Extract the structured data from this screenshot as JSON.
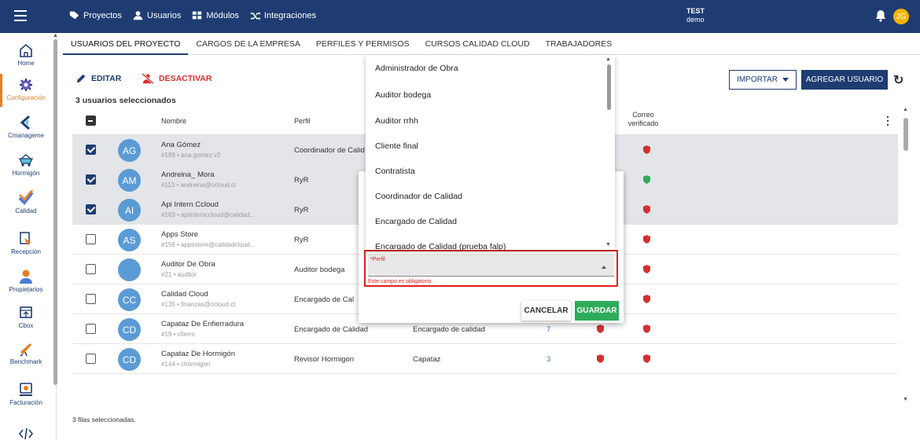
{
  "topbar": {
    "nav": [
      "Proyectos",
      "Usuarios",
      "Módulos",
      "Integraciones"
    ],
    "org_name": "TEST",
    "org_sub": "demo",
    "avatar_initials": "JG",
    "colors": {
      "bar": "#1e3c72",
      "avatar": "#f5b400"
    }
  },
  "sidebar": {
    "items": [
      "Home",
      "Configuración",
      "Cmanageme",
      "Hormigón",
      "Calidad",
      "Recepción",
      "Propietarios",
      "Cbox",
      "Benchmark",
      "Facturación"
    ]
  },
  "tabs": [
    "USUARIOS DEL PROYECTO",
    "CARGOS DE LA EMPRESA",
    "PERFILES Y PERMISOS",
    "CURSOS CALIDAD CLOUD",
    "TRABAJADORES"
  ],
  "toolbar": {
    "edit": "EDITAR",
    "deactivate": "DESACTIVAR",
    "selected_count": "3 usuarios seleccionados",
    "import": "IMPORTAR",
    "add_user": "AGREGAR USUARIO"
  },
  "table": {
    "headers": {
      "name": "Nombre",
      "profile": "Perfil",
      "verified": "Correo verificado"
    },
    "rows": [
      {
        "initials": "AG",
        "name": "Ana Gómez",
        "sub": "#199 • ana.gomez.v2",
        "profile": "Coordinador de Calid",
        "charge": "",
        "count": "",
        "selected": true,
        "shield1": "",
        "shield2": "red"
      },
      {
        "initials": "AM",
        "name": "Andreina_ Mora",
        "sub": "#113 • andreina@ccloud.cl",
        "profile": "RyR",
        "charge": "",
        "count": "",
        "selected": true,
        "shield1": "",
        "shield2": "green"
      },
      {
        "initials": "AI",
        "name": "Api Intern Ccloud",
        "sub": "#163 • apiinternccloud@calidad...",
        "profile": "RyR",
        "charge": "",
        "count": "",
        "selected": true,
        "shield1": "",
        "shield2": "red"
      },
      {
        "initials": "AS",
        "name": "Apps Store",
        "sub": "#156 • appsstore@calidadcloud...",
        "profile": "RyR",
        "charge": "",
        "count": "",
        "selected": false,
        "shield1": "",
        "shield2": "red"
      },
      {
        "initials": "",
        "name": "Auditor De Obra",
        "sub": "#21 • auditor",
        "profile": "Auditor bodega",
        "charge": "",
        "count": "",
        "selected": false,
        "shield1": "",
        "shield2": "red"
      },
      {
        "initials": "CC",
        "name": "Calidad Cloud",
        "sub": "#135 • finanzas@ccloud.cl",
        "profile": "Encargado de Cal",
        "charge": "",
        "count": "",
        "selected": false,
        "shield1": "",
        "shield2": "red"
      },
      {
        "initials": "CD",
        "name": "Capataz De Enfierradura",
        "sub": "#19 • cfierro",
        "profile": "Encargado de Calidad",
        "charge": "Encargado de calidad",
        "count": "7",
        "selected": false,
        "shield1": "red",
        "shield2": "red"
      },
      {
        "initials": "CD",
        "name": "Capataz De Hormigón",
        "sub": "#144 • chormigon",
        "profile": "Revisor Hormigon",
        "charge": "Capataz",
        "count": "3",
        "selected": false,
        "shield1": "red",
        "shield2": "red"
      }
    ]
  },
  "footer": "3 filas seleccionadas.",
  "modal": {
    "field_label": "*Perfil",
    "error": "Este campo es obligatorio.",
    "cancel": "CANCELAR",
    "save": "GUARDAR"
  },
  "dropdown": {
    "options": [
      "Administrador de Obra",
      "Auditor bodega",
      "Auditor rrhh",
      "Cliente final",
      "Contratista",
      "Coordinador de Calidad",
      "Encargado de Calidad",
      "Encargado de Calidad (prueba falp)"
    ]
  }
}
